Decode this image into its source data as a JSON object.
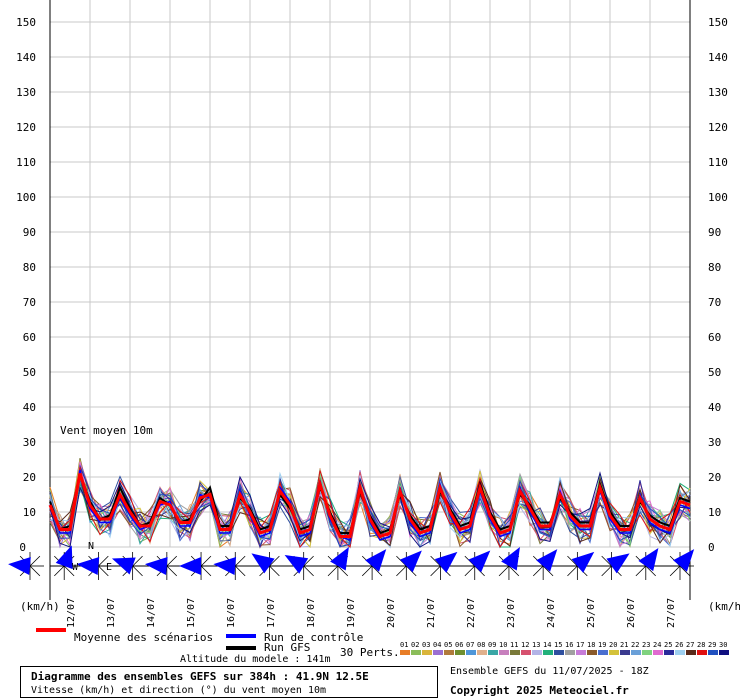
{
  "chart_data": {
    "type": "line",
    "title": "Diagramme des ensembles GEFS sur 384h : 41.9N 12.5E",
    "subtitle": "Vitesse (km/h) et direction (°) du vent moyen 10m",
    "series_label": "Vent moyen 10m",
    "ylabel_left": "(km/h)",
    "ylabel_right": "(km/h)",
    "ylim": [
      0,
      155
    ],
    "yticks": [
      0,
      10,
      20,
      30,
      40,
      50,
      60,
      70,
      80,
      90,
      100,
      110,
      120,
      130,
      140,
      150
    ],
    "grid": true,
    "x_dates": [
      "12/07",
      "13/07",
      "14/07",
      "15/07",
      "16/07",
      "17/07",
      "18/07",
      "19/07",
      "20/07",
      "21/07",
      "22/07",
      "23/07",
      "24/07",
      "25/07",
      "26/07",
      "27/07"
    ],
    "x_start_date_label": "11/07 18Z",
    "step_hours": 6,
    "mean": [
      12,
      5,
      5,
      21,
      12,
      8,
      8,
      15,
      10,
      6,
      6,
      13,
      12,
      7,
      7,
      14,
      15,
      5,
      5,
      15,
      10,
      4,
      5,
      16,
      12,
      4,
      5,
      18,
      9,
      3,
      3,
      17,
      8,
      3,
      4,
      16,
      8,
      4,
      5,
      17,
      10,
      5,
      6,
      17,
      9,
      4,
      5,
      16,
      11,
      6,
      6,
      15,
      9,
      6,
      6,
      17,
      9,
      5,
      5,
      14,
      8,
      6,
      5,
      13,
      12
    ],
    "control": [
      12,
      4,
      4,
      22,
      11,
      7,
      7,
      14,
      9,
      5,
      6,
      12,
      13,
      6,
      6,
      15,
      14,
      4,
      4,
      16,
      9,
      3,
      4,
      17,
      13,
      3,
      4,
      19,
      8,
      3,
      2,
      18,
      7,
      2,
      3,
      17,
      7,
      3,
      4,
      18,
      9,
      4,
      5,
      16,
      8,
      3,
      4,
      17,
      10,
      5,
      5,
      16,
      8,
      5,
      5,
      16,
      8,
      4,
      4,
      15,
      7,
      5,
      4,
      12,
      11
    ],
    "gfs": [
      13,
      5,
      6,
      21,
      13,
      8,
      9,
      17,
      11,
      6,
      7,
      14,
      12,
      7,
      8,
      13,
      17,
      6,
      6,
      14,
      11,
      5,
      6,
      15,
      11,
      5,
      6,
      17,
      10,
      4,
      4,
      16,
      9,
      4,
      5,
      15,
      9,
      5,
      6,
      16,
      11,
      6,
      7,
      18,
      10,
      5,
      6,
      15,
      12,
      7,
      7,
      14,
      10,
      7,
      7,
      18,
      10,
      6,
      6,
      13,
      9,
      7,
      6,
      14,
      13
    ],
    "perturbation_count": 30,
    "perturbation_colors": [
      "#e87d27",
      "#8bbd5a",
      "#d9b53b",
      "#9b6fd1",
      "#b07a3c",
      "#6f8f2f",
      "#4f96d8",
      "#e0b08c",
      "#3aa6a6",
      "#c77fbd",
      "#7a7a3a",
      "#d6506e",
      "#b3b3e6",
      "#21b07a",
      "#2f4f9f",
      "#a0a0a0",
      "#c67cd8",
      "#8a5a2b",
      "#4a6fd0",
      "#d4c23a",
      "#3b3b8f",
      "#6aa0d8",
      "#7fd27f",
      "#e06ad0",
      "#2a2a9a",
      "#9fd0f0",
      "#5a2a1a",
      "#e01010",
      "#2050c0",
      "#101080"
    ],
    "wind_direction_deg": [
      95,
      200,
      95,
      110,
      95,
      90,
      95,
      125,
      120,
      210,
      220,
      225,
      230,
      225,
      210,
      220,
      230,
      235,
      215,
      220
    ],
    "legend": {
      "mean": "Moyenne des scénarios",
      "control": "Run de contrôle",
      "gfs": "Run GFS",
      "perts": "30 Perts.",
      "pert_numbers": [
        "01",
        "02",
        "03",
        "04",
        "05",
        "06",
        "07",
        "08",
        "09",
        "10",
        "11",
        "12",
        "13",
        "14",
        "15",
        "16",
        "17",
        "18",
        "19",
        "20",
        "21",
        "22",
        "23",
        "24",
        "25",
        "26",
        "27",
        "28",
        "29",
        "30"
      ]
    },
    "colors": {
      "mean": "#ff0000",
      "control": "#0000ff",
      "gfs": "#000000",
      "wind": "#0000ff",
      "grid": "#c8c8c8"
    }
  },
  "footer": {
    "altitude": "Altitude du modele : 141m",
    "run_info": "Ensemble GEFS du 11/07/2025 - 18Z",
    "copyright": "Copyright 2025 Meteociel.fr"
  },
  "compass": {
    "N": "N",
    "W": "W",
    "E": "E"
  }
}
